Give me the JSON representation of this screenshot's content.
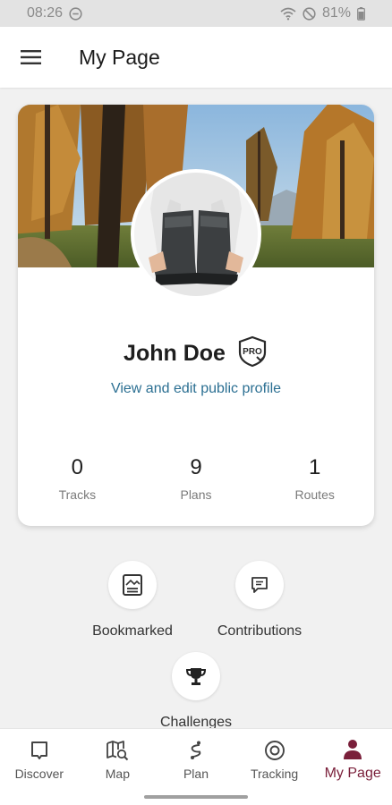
{
  "status_bar": {
    "time": "08:26",
    "battery": "81%"
  },
  "header": {
    "title": "My Page"
  },
  "profile": {
    "name": "John Doe",
    "edit_link": "View and edit public profile",
    "badge_text": "PRO"
  },
  "stats": [
    {
      "value": "0",
      "label": "Tracks"
    },
    {
      "value": "9",
      "label": "Plans"
    },
    {
      "value": "1",
      "label": "Routes"
    }
  ],
  "actions": [
    {
      "label": "Bookmarked",
      "icon": "bookmark-icon"
    },
    {
      "label": "Contributions",
      "icon": "speech-bubble-icon"
    },
    {
      "label": "Challenges",
      "icon": "trophy-icon"
    }
  ],
  "nav": [
    {
      "label": "Discover",
      "icon": "discover-icon"
    },
    {
      "label": "Map",
      "icon": "map-icon"
    },
    {
      "label": "Plan",
      "icon": "plan-icon"
    },
    {
      "label": "Tracking",
      "icon": "tracking-icon"
    },
    {
      "label": "My Page",
      "icon": "person-icon",
      "active": true
    }
  ],
  "colors": {
    "accent": "#7a1f3a",
    "link": "#2b6f92",
    "background": "#f1f1f1"
  }
}
